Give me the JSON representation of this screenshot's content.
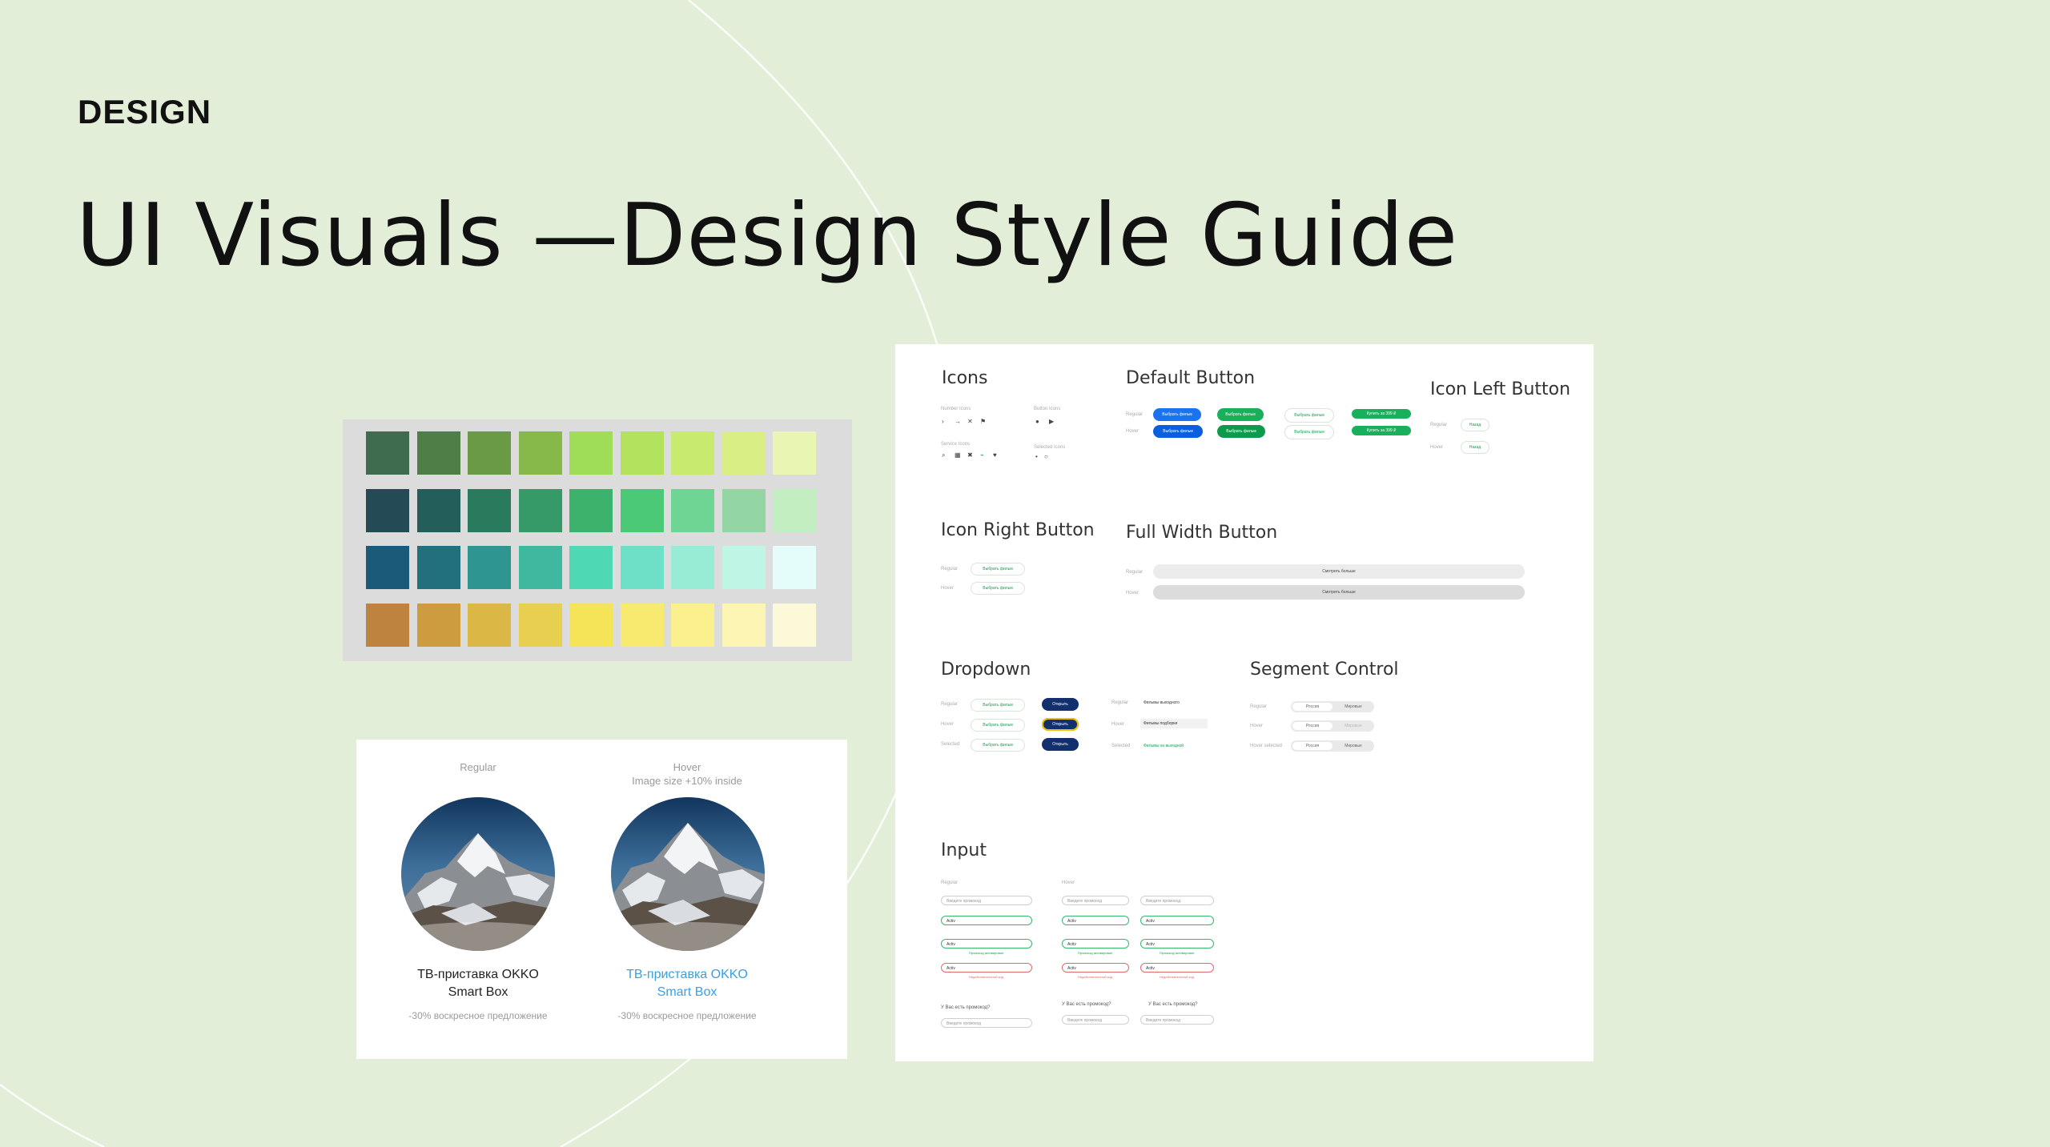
{
  "header": {
    "eyebrow": "DESIGN",
    "title": "UI Visuals —Design Style Guide"
  },
  "palette": {
    "rows": [
      [
        "#3f6b4e",
        "#4f7f47",
        "#6a9a45",
        "#86b84a",
        "#9fdc57",
        "#b2e25e",
        "#c8ea6e",
        "#d9ef86",
        "#e9f5b2"
      ],
      [
        "#234a55",
        "#245e5a",
        "#2a7a5e",
        "#359a68",
        "#3cb26c",
        "#4cc977",
        "#6fd594",
        "#93d6a4",
        "#c2eec2"
      ],
      [
        "#1b5a78",
        "#226f7e",
        "#2f9590",
        "#3fb8a0",
        "#4fd8b4",
        "#6fe0c8",
        "#98ecd6",
        "#bff5e4",
        "#e4fdfb"
      ],
      [
        "#be833e",
        "#cc9c3e",
        "#dbb745",
        "#e9cf50",
        "#f6e458",
        "#f7ea6e",
        "#fbf08e",
        "#fcf5b4",
        "#fcf9d8"
      ]
    ]
  },
  "card_demo": {
    "regular_label": "Regular",
    "hover_label": "Hover",
    "hover_note": "Image size +10% inside",
    "product_title_line1": "ТВ-приставка OKKO",
    "product_title_line2": "Smart Box",
    "product_subtitle": "-30% воскресное предложение",
    "hover_color": "#3aa0e0"
  },
  "style_guide": {
    "sections": {
      "icons": "Icons",
      "default_button": "Default Button",
      "icon_left_button": "Icon Left Button",
      "icon_right_button": "Icon Right Button",
      "full_width_button": "Full Width Button",
      "dropdown": "Dropdown",
      "segment_control": "Segment Control",
      "input": "Input"
    },
    "labels": {
      "regular": "Regular",
      "hover": "Hover",
      "selected": "Selected",
      "number_icons": "Number Icons",
      "button_icons": "Button Icons",
      "service_icons": "Service Icons",
      "selected_icons": "Selected Icons",
      "hover_selected": "Hover selected"
    },
    "button_text": "Выбрать фильм",
    "button_icon_text": "Выбрать фильм",
    "play_button_text": "Купить за 399 ₽",
    "icon_left_text": "Назад",
    "full_width_text": "Смотреть больше",
    "dropdown_pill_text": "Открыть",
    "dropdown_item_1": "Фильмы выходного",
    "dropdown_item_2": "Фильмы подборки",
    "dropdown_item_3": "Фильмы на выходной",
    "segment_on": "Россия",
    "segment_off": "Мировые",
    "input_placeholder": "Введите промокод",
    "input_value": "Activ",
    "input_hint": "Промокод активирован",
    "input_error": "Недействительный код",
    "input_question": "У Вас есть промокод?"
  }
}
